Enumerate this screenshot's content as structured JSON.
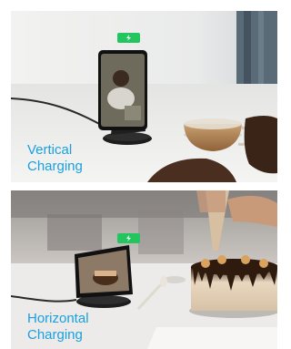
{
  "panels": [
    {
      "caption_line1": "Vertical",
      "caption_line2": "Charging"
    },
    {
      "caption_line1": "Horizontal",
      "caption_line2": "Charging"
    }
  ],
  "colors": {
    "caption": "#1aa0e0",
    "indicator": "#22c55e",
    "background": "#ffffff"
  },
  "icons": [
    "battery-charging-icon"
  ]
}
